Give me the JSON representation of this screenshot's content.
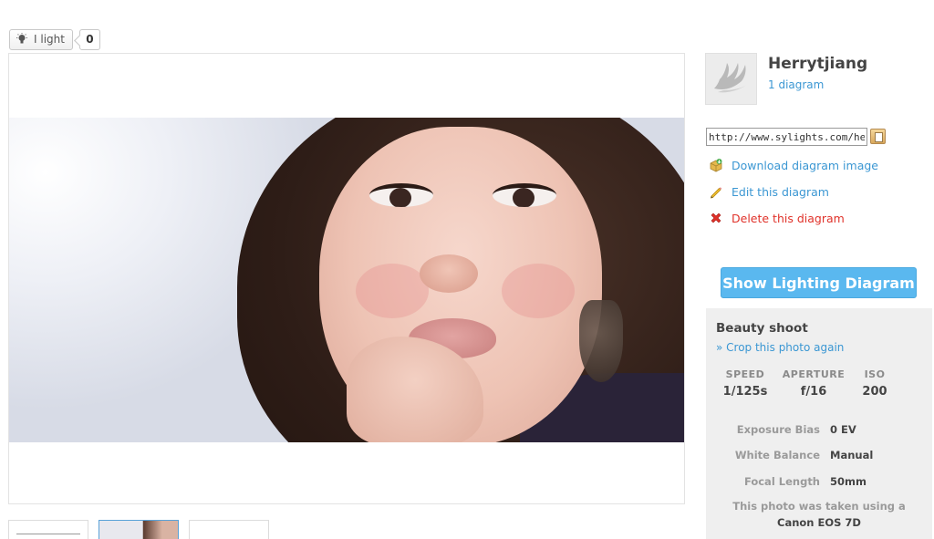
{
  "like": {
    "label": "I light",
    "count": "0"
  },
  "user": {
    "name": "Herrytjiang",
    "diagrams": "1 diagram"
  },
  "share": {
    "url": "http://www.sylights.com/herrytjiang"
  },
  "actions": {
    "download": "Download diagram image",
    "edit": "Edit this diagram",
    "delete": "Delete this diagram"
  },
  "show_button": "Show Lighting Diagram",
  "photo_info": {
    "title": "Beauty shoot",
    "crop_link": "» Crop this photo again",
    "stats": [
      {
        "label": "SPEED",
        "value": "1/125s"
      },
      {
        "label": "APERTURE",
        "value": "f/16"
      },
      {
        "label": "ISO",
        "value": "200"
      }
    ],
    "exif": [
      {
        "key": "Exposure Bias",
        "value": "0 EV"
      },
      {
        "key": "White Balance",
        "value": "Manual"
      },
      {
        "key": "Focal Length",
        "value": "50mm"
      }
    ],
    "camera_note": "This photo was taken using a",
    "camera_model": "Canon EOS 7D"
  },
  "colors": {
    "link": "#3b97d3",
    "delete": "#e0322a",
    "button": "#5ab8ef",
    "panel": "#efefef"
  },
  "icons": {
    "like": "lightbulb-icon",
    "download": "download-box-icon",
    "edit": "pencil-icon",
    "delete": "red-x-icon",
    "copy": "clipboard-icon"
  }
}
